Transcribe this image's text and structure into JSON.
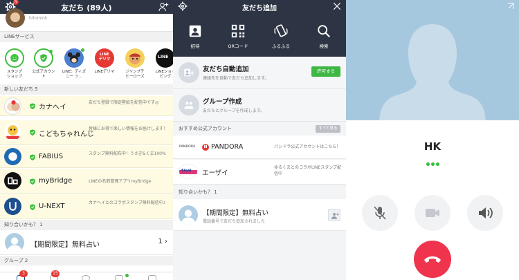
{
  "friends_screen": {
    "title": "友だち (89人)",
    "gear_badge": "N",
    "profile_id": "hitomink",
    "services_label": "LINEサービス",
    "services": [
      {
        "label": "スタンプ\nショップ",
        "color": "#3dbe3d",
        "icon": "smile-icon"
      },
      {
        "label": "公式アカウント",
        "color": "#3dbe3d",
        "icon": "shield-icon"
      },
      {
        "label": "LINE：ディズニー ツ…",
        "color": "#4b7fd0",
        "icon": "disney-icon"
      },
      {
        "label": "LINEデリマ",
        "color": "#e53935",
        "icon": "delima-icon",
        "logo_text": "LINE\nデリマ"
      },
      {
        "label": "ジャンプチ\nヒーローズ",
        "color": "#f0a020",
        "icon": "game-icon"
      },
      {
        "label": "LINEショッピング",
        "color": "#111111",
        "icon": "shopping-icon",
        "logo_text": "LINE"
      }
    ],
    "new_friends_label": "新しい友だち 5",
    "new_friends": [
      {
        "name": "カナヘイ",
        "desc": "友だち登録で限定壁紙を配信中です◎"
      },
      {
        "name": "こどもちゃれんじ",
        "desc": "皆様にお得で楽しい情報をお届けします！"
      },
      {
        "name": "FABIUS",
        "desc": "スタンプ無料配布中！うさぎ&くま100%"
      },
      {
        "name": "myBridge",
        "desc": "LINEの名刺管理アプリmyBridge"
      },
      {
        "name": "U-NEXT",
        "desc": "カナヘイとのコラボスタンプ無料配信中♪"
      }
    ],
    "know_label": "知り合いかも？ 1",
    "know_name": "【期間限定】無料占い",
    "know_count": "1",
    "groups_label": "グループ 2",
    "tab_badges": [
      "3",
      "15"
    ]
  },
  "add_screen": {
    "title": "友だち追加",
    "quick_actions": [
      {
        "label": "招待",
        "icon": "invite-icon"
      },
      {
        "label": "QRコード",
        "icon": "qr-code-icon"
      },
      {
        "label": "ふるふる",
        "icon": "shake-icon"
      },
      {
        "label": "検索",
        "icon": "search-icon"
      }
    ],
    "auto_add_title": "友だち自動追加",
    "auto_add_desc": "連絡先を自動で友だち追加します。",
    "allow_label": "許可する",
    "group_title": "グループ作成",
    "group_desc": "友だちとグループを作成します。",
    "recommended_label": "おすすめ公式アカウント",
    "see_all_label": "すべて見る",
    "accounts": [
      {
        "name": "PANDORA",
        "desc": "パンドラ公式アカウントはこちら！",
        "badge": "N",
        "logo_text": "PANDORA"
      },
      {
        "name": "エーザイ",
        "desc": "ゆるくまとのコラボLINEスタンプ配信中",
        "logo_text": "Eisai"
      }
    ],
    "know_label": "知り合いかも？ 1",
    "know_name": "【期間限定】無料占い",
    "know_desc": "電話番号で友だち追加されました"
  },
  "call_screen": {
    "caller": "HK",
    "colors": {
      "accent_green": "#2fbf3b",
      "end_call": "#f0344d"
    }
  }
}
